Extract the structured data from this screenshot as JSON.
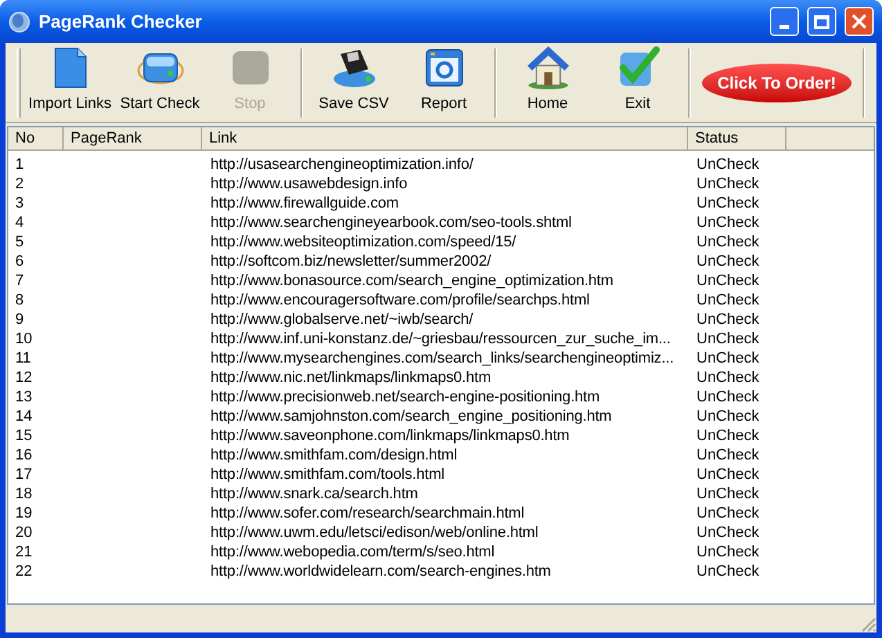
{
  "window": {
    "title": "PageRank Checker"
  },
  "toolbar": {
    "groups": [
      [
        {
          "label": "Import Links",
          "disabled": false
        },
        {
          "label": "Start Check",
          "disabled": false
        },
        {
          "label": "Stop",
          "disabled": true
        }
      ],
      [
        {
          "label": "Save CSV",
          "disabled": false
        },
        {
          "label": "Report",
          "disabled": false
        }
      ],
      [
        {
          "label": "Home",
          "disabled": false
        },
        {
          "label": "Exit",
          "disabled": false
        }
      ]
    ],
    "order_button": {
      "label": "Click To Order!"
    }
  },
  "table": {
    "columns": [
      "No",
      "PageRank",
      "Link",
      "Status"
    ],
    "rows": [
      {
        "no": "1",
        "link": "http://usasearchengineoptimization.info/",
        "status": "UnCheck"
      },
      {
        "no": "2",
        "link": "http://www.usawebdesign.info",
        "status": "UnCheck"
      },
      {
        "no": "3",
        "link": "http://www.firewallguide.com",
        "status": "UnCheck"
      },
      {
        "no": "4",
        "link": "http://www.searchengineyearbook.com/seo-tools.shtml",
        "status": "UnCheck"
      },
      {
        "no": "5",
        "link": "http://www.websiteoptimization.com/speed/15/",
        "status": "UnCheck"
      },
      {
        "no": "6",
        "link": "http://softcom.biz/newsletter/summer2002/",
        "status": "UnCheck"
      },
      {
        "no": "7",
        "link": "http://www.bonasource.com/search_engine_optimization.htm",
        "status": "UnCheck"
      },
      {
        "no": "8",
        "link": "http://www.encouragersoftware.com/profile/searchps.html",
        "status": "UnCheck"
      },
      {
        "no": "9",
        "link": "http://www.globalserve.net/~iwb/search/",
        "status": "UnCheck"
      },
      {
        "no": "10",
        "link": "http://www.inf.uni-konstanz.de/~griesbau/ressourcen_zur_suche_im...",
        "status": "UnCheck"
      },
      {
        "no": "11",
        "link": "http://www.mysearchengines.com/search_links/searchengineoptimiz...",
        "status": "UnCheck"
      },
      {
        "no": "12",
        "link": "http://www.nic.net/linkmaps/linkmaps0.htm",
        "status": "UnCheck"
      },
      {
        "no": "13",
        "link": "http://www.precisionweb.net/search-engine-positioning.htm",
        "status": "UnCheck"
      },
      {
        "no": "14",
        "link": "http://www.samjohnston.com/search_engine_positioning.htm",
        "status": "UnCheck"
      },
      {
        "no": "15",
        "link": "http://www.saveonphone.com/linkmaps/linkmaps0.htm",
        "status": "UnCheck"
      },
      {
        "no": "16",
        "link": "http://www.smithfam.com/design.html",
        "status": "UnCheck"
      },
      {
        "no": "17",
        "link": "http://www.smithfam.com/tools.html",
        "status": "UnCheck"
      },
      {
        "no": "18",
        "link": "http://www.snark.ca/search.htm",
        "status": "UnCheck"
      },
      {
        "no": "19",
        "link": "http://www.sofer.com/research/searchmain.html",
        "status": "UnCheck"
      },
      {
        "no": "20",
        "link": "http://www.uwm.edu/letsci/edison/web/online.html",
        "status": "UnCheck"
      },
      {
        "no": "21",
        "link": "http://www.webopedia.com/term/s/seo.html",
        "status": "UnCheck"
      },
      {
        "no": "22",
        "link": "http://www.worldwidelearn.com/search-engines.htm",
        "status": "UnCheck"
      }
    ]
  }
}
